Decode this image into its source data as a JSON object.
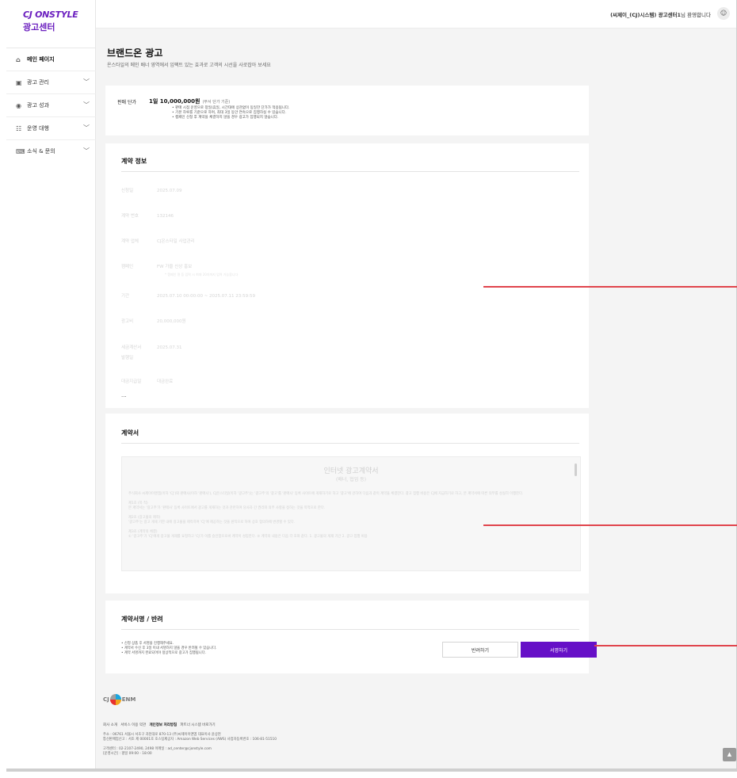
{
  "logo": {
    "line1": "CJ ONSTYLE",
    "line2": "광고센터"
  },
  "header": {
    "user_name": "(씨제이_(CJ)시스템) 광고센터1",
    "welcome_suffix": "님 환영합니다",
    "user_icon": "user-icon"
  },
  "sidebar": {
    "items": [
      {
        "label": "메인 페이지",
        "icon": "⌂",
        "active": true,
        "has_chevron": false
      },
      {
        "label": "광고 관리",
        "icon": "▣",
        "active": false,
        "has_chevron": true
      },
      {
        "label": "광고 성과",
        "icon": "◉",
        "active": false,
        "has_chevron": true
      },
      {
        "label": "운영 대행",
        "icon": "☷",
        "active": false,
        "has_chevron": true
      },
      {
        "label": "소식 & 문의",
        "icon": "⌨",
        "active": false,
        "has_chevron": true
      }
    ]
  },
  "page": {
    "title": "브랜드온 광고",
    "subtitle": "온스타일의 메인 배너 영역에서 임팩트 있는 효과로 고객의 시선을 사로잡아 보세요"
  },
  "price": {
    "label": "판매 단가",
    "value": "1일 10,000,000원",
    "value_note": "(부서 단가 기준)",
    "notes": [
      "판매 시점 운영으로 창일(휴일, 시간대에 상관없이 동일한 단가가 적용됩니다.",
      "기본 하루를 기준으로 하며, 최대 3일 동안 연속으로 집행하실 수 있습니다.",
      "캠페인 신청 후 계약을 체결하지 않을 경우 광고가 집행되지 않습니다."
    ]
  },
  "contract": {
    "title": "계약 정보",
    "rows": [
      {
        "k": "신청일",
        "v": "2025.07.09"
      },
      {
        "k": "계약 번호",
        "v": "132146"
      },
      {
        "k": "계약 업체",
        "v": "CJ온스타일 사업관리"
      },
      {
        "k": "캠페인",
        "v": "FW 가을 신상 홍보"
      },
      {
        "k": "기간",
        "v": "2025.07.10 00:00:00 ~ 2025.07.11 23:59:59"
      },
      {
        "k": "광고비",
        "v": "20,000,000원"
      },
      {
        "k": "세금계산서",
        "v": "2025.07.31"
      },
      {
        "k": "발행일",
        "v": ""
      },
      {
        "k": "대금지급일",
        "v": "대금완료"
      }
    ],
    "campaign_note": "* 캠페인 명 등 입력 시 최대 20자까지 입력 가능합니다",
    "more": "..."
  },
  "document": {
    "title": "계약서",
    "doc_title": "인터넷 광고계약서",
    "doc_subtitle": "(배너, 협업 등)",
    "intro": "주식회사 씨제이이엔엠(이하 'CJ')와 판매사(이하 '판매사'), CJ온스타일(이하 '광고주')는 '광고주'의 '광고'를 '판매사' 등록 사이트에 게재하기로 하고 '광고'에 관하여 다음과 같이 계약을 체결한다. 광고 집행 비용은 CJ에 지급하기로 하고, 본 계약서에 따른 의무를 성실히 이행한다.",
    "art1_title": "제1조 (목 적)",
    "art1_body": "본 계약서는 '광고주'가 '판매사' 등록 사이트에서 광고를 게재하는 것과 관련하여 당사자 간 권리와 의무 사항을 정하는 것을 목적으로 한다.",
    "art2_title": "제2조 (광고물의 제작)",
    "art2_body": "'광고주'는 광고 게재 기한 내에 광고물을 제작하여 'CJ'에 제공하는 것을 원칙으로 하며 상호 협의하에 변경할 수 있다.",
    "art3_title": "제3조 (계약의 체결)",
    "art3_body": "① '광고주'가 'CJ'에게 광고물 게재를 요청하고 'CJ'가 이를 승인함으로써 계약이 성립한다. ② 계약의 내용은 다음 각 호와 같다. 1. 광고물의 게재 기간 2. 광고 집행 비용"
  },
  "signature": {
    "title": "계약서명 / 반려",
    "notes": [
      "신청 상품 후 서명을 진행해주세요.",
      "계약서 수신 후 3일 이내 서명하지 않을 경우 반려될 수 있습니다.",
      "계약 서명까지 완료되어야 정상적으로 광고가 집행됩니다."
    ],
    "reject_label": "반려하기",
    "sign_label": "서명하기"
  },
  "footer": {
    "brand": "ENM",
    "links": [
      "회사 소개",
      "서비스 이용 약관",
      "개인정보 처리방침",
      "파트너 시스템 바로가기"
    ],
    "address": "주소 : 06761 서울시 서초구 과천대로 870-13   (주)씨제이이엔엠 대표이사 윤상현",
    "business": "통신판매업신고 : 서초 제 00001호   호스팅제공자 : Amazon Web Services (AWS)   사업자등록번호 : 106-81-51510",
    "contact": "고객센터 : 02-2107-2490, 2498   이메일 : ad_center@cjonstyle.com",
    "hours": "[운영시간] : 평일 09:00 - 18:00",
    "top_button": "▲"
  }
}
